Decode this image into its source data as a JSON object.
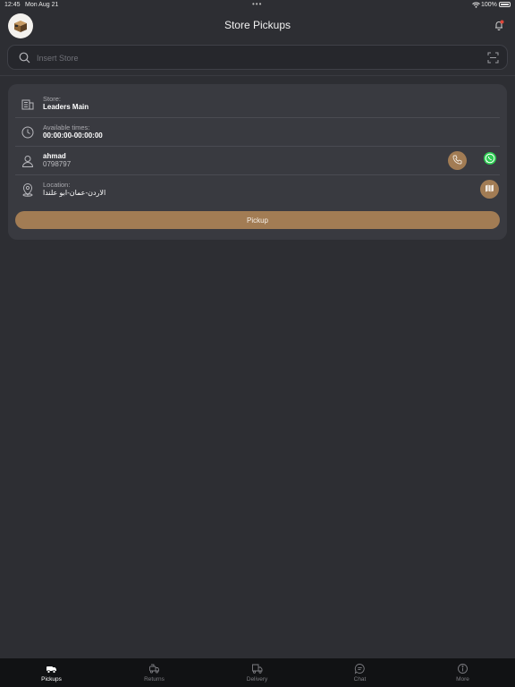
{
  "status_bar": {
    "time": "12:45",
    "date": "Mon Aug 21",
    "dots": "•••",
    "battery": "100%"
  },
  "header": {
    "title": "Store Pickups",
    "logo_icon": "store-box-logo-icon",
    "notification_icon": "bell-icon"
  },
  "search": {
    "placeholder": "Insert Store",
    "value": "",
    "search_icon": "search-icon",
    "scan_icon": "scan-icon"
  },
  "pickup_card": {
    "store_label": "Store:",
    "store_value": "Leaders Main",
    "times_label": "Available times:",
    "times_value": "00:00:00-00:00:00",
    "contact_name": "ahmad",
    "contact_phone": "0798797",
    "location_label": "Location:",
    "location_value": "الاردن-عمان-ابو علندا",
    "pickup_button": "Pickup"
  },
  "tabs": [
    {
      "label": "Pickups",
      "icon": "pickups-icon",
      "active": true
    },
    {
      "label": "Returns",
      "icon": "returns-icon",
      "active": false
    },
    {
      "label": "Delivery",
      "icon": "delivery-truck-icon",
      "active": false
    },
    {
      "label": "Chat",
      "icon": "chat-icon",
      "active": false
    },
    {
      "label": "More",
      "icon": "more-info-icon",
      "active": false
    }
  ],
  "colors": {
    "background": "#2d2e33",
    "card": "#393a40",
    "accent": "#a27c54",
    "tabbar": "#111214"
  }
}
